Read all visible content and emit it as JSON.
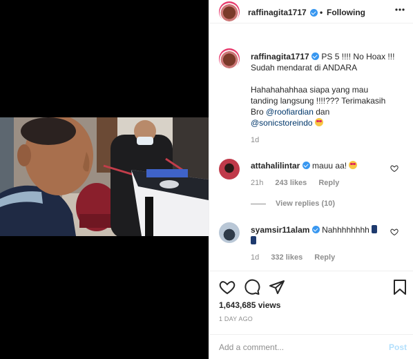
{
  "header": {
    "username": "raffinagita1717",
    "separator": "•",
    "follow_state": "Following",
    "more_icon": "more-horizontal-icon"
  },
  "caption": {
    "username": "raffinagita1717",
    "line1": "PS 5 !!!! No Hoax !!!",
    "line2": "Sudah mendarat di ANDARA",
    "line3": "Hahahahahhaa siapa yang mau",
    "line4": "tanding langsung !!!!??? Terimakasih",
    "line5_prefix": "Bro ",
    "mention1": "@roofiardian",
    "line5_suffix": " dan",
    "mention2": "@sonicstoreindo",
    "time": "1d"
  },
  "comments": [
    {
      "username": "attahalilintar",
      "text": "mauu aa!",
      "time": "21h",
      "likes": "243 likes",
      "reply": "Reply",
      "view_replies": "View replies (10)"
    },
    {
      "username": "syamsir11alam",
      "text": "Nahhhhhhhh",
      "time": "1d",
      "likes": "332 likes",
      "reply": "Reply"
    }
  ],
  "actions": {
    "views": "1,643,685 views",
    "date": "1 DAY AGO"
  },
  "composer": {
    "placeholder": "Add a comment...",
    "post_label": "Post"
  },
  "colors": {
    "verified": "#3897f0",
    "link": "#00376b",
    "post_disabled": "#b2dffc"
  }
}
